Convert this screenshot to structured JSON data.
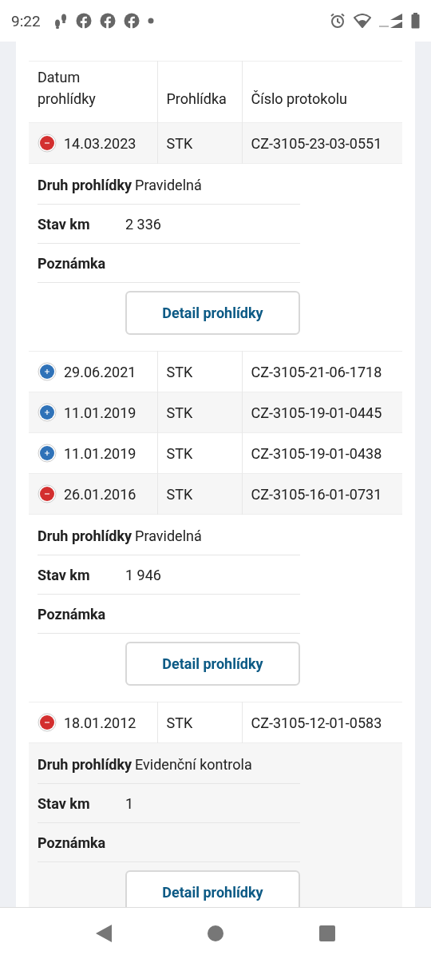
{
  "status_bar": {
    "time": "9:22"
  },
  "table": {
    "columns": [
      "Datum prohlídky",
      "Prohlídka",
      "Číslo protokolu"
    ],
    "rows": [
      {
        "date": "14.03.2023",
        "type": "STK",
        "protocol": "CZ-3105-23-03-0551",
        "expanded": true,
        "details": {
          "kind_label": "Druh prohlídky",
          "kind_value": "Pravidelná",
          "km_label": "Stav km",
          "km_value": "2 336",
          "note_label": "Poznámka",
          "button": "Detail prohlídky"
        }
      },
      {
        "date": "29.06.2021",
        "type": "STK",
        "protocol": "CZ-3105-21-06-1718",
        "expanded": false
      },
      {
        "date": "11.01.2019",
        "type": "STK",
        "protocol": "CZ-3105-19-01-0445",
        "expanded": false
      },
      {
        "date": "11.01.2019",
        "type": "STK",
        "protocol": "CZ-3105-19-01-0438",
        "expanded": false
      },
      {
        "date": "26.01.2016",
        "type": "STK",
        "protocol": "CZ-3105-16-01-0731",
        "expanded": true,
        "details": {
          "kind_label": "Druh prohlídky",
          "kind_value": "Pravidelná",
          "km_label": "Stav km",
          "km_value": "1 946",
          "note_label": "Poznámka",
          "button": "Detail prohlídky"
        }
      },
      {
        "date": "18.01.2012",
        "type": "STK",
        "protocol": "CZ-3105-12-01-0583",
        "expanded": true,
        "details": {
          "kind_label": "Druh prohlídky",
          "kind_value": "Evidenční kontrola",
          "km_label": "Stav km",
          "km_value": "1",
          "note_label": "Poznámka",
          "button": "Detail prohlídky"
        }
      }
    ]
  }
}
